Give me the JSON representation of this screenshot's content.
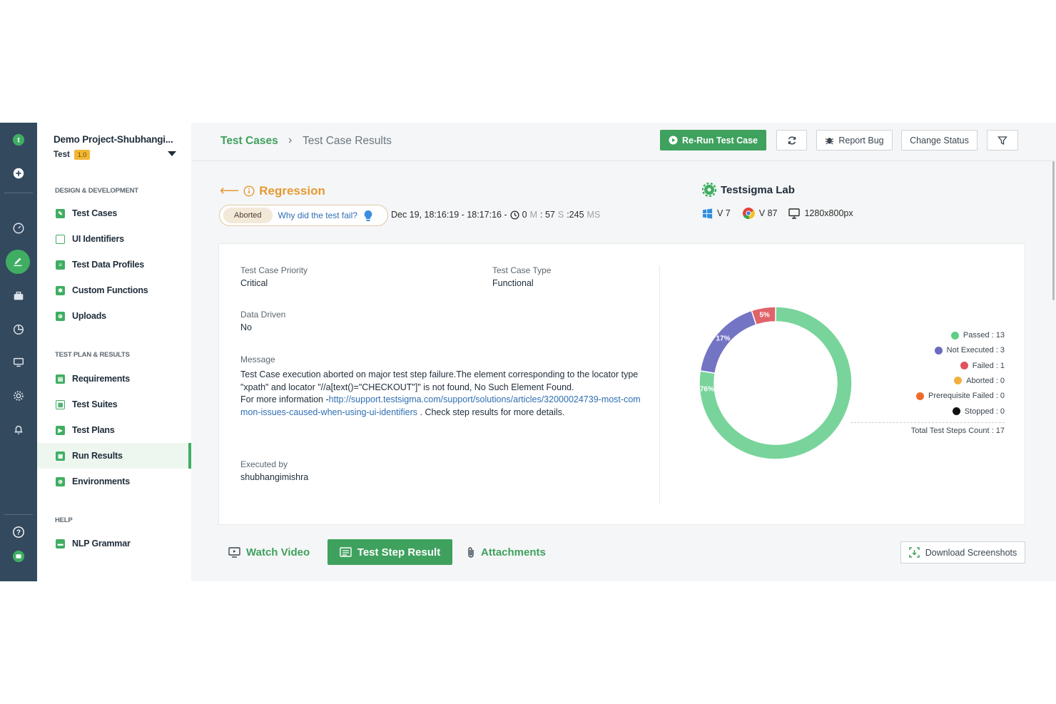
{
  "sidebar": {
    "project_name": "Demo Project-Shubhangi...",
    "project_sub": "Test",
    "version": "1.0",
    "sections": [
      {
        "title": "DESIGN & DEVELOPMENT",
        "items": [
          "Test Cases",
          "UI Identifiers",
          "Test Data Profiles",
          "Custom Functions",
          "Uploads"
        ]
      },
      {
        "title": "TEST PLAN & RESULTS",
        "items": [
          "Requirements",
          "Test Suites",
          "Test Plans",
          "Run Results",
          "Environments"
        ]
      },
      {
        "title": "HELP",
        "items": [
          "NLP Grammar"
        ]
      }
    ],
    "selected": "Run Results"
  },
  "header": {
    "breadcrumb_root": "Test Cases",
    "breadcrumb_current": "Test Case Results",
    "rerun_label": "Re-Run Test Case",
    "report_bug_label": "Report Bug",
    "change_status_label": "Change Status"
  },
  "run": {
    "title": "Regression",
    "status": "Aborted",
    "why_link": "Why did the test fail?",
    "time_range": "Dec 19, 18:16:19 - 18:17:16 -",
    "duration_m_value": "0",
    "duration_m_unit": "M",
    "duration_s_value": ": 57",
    "duration_s_unit": "S",
    "duration_ms_value": ":245",
    "duration_ms_unit": "MS",
    "lab": "Testsigma Lab",
    "os_version": "V 7",
    "browser_version": "V 87",
    "resolution": "1280x800px"
  },
  "details": {
    "priority_label": "Test Case Priority",
    "priority_value": "Critical",
    "type_label": "Test Case Type",
    "type_value": "Functional",
    "data_driven_label": "Data Driven",
    "data_driven_value": "No",
    "message_label": "Message",
    "message_line1": "Test Case execution aborted on major test step failure.The element corresponding to the locator type \"xpath\" and locator \"//a[text()=\"CHECKOUT\"]\" is not found, No Such Element Found.",
    "message_prefix": "For more information -",
    "message_link": "http://support.testsigma.com/support/solutions/articles/32000024739-most-common-issues-caused-when-using-ui-identifiers",
    "message_suffix": " . Check step results for more details.",
    "executed_by_label": "Executed by",
    "executed_by_value": "shubhangimishra"
  },
  "chart_data": {
    "type": "pie",
    "categories": [
      "Passed",
      "Not Executed",
      "Failed"
    ],
    "values": [
      76,
      17,
      5
    ],
    "slice_labels": [
      "76%",
      "17%",
      "5%"
    ],
    "colors": [
      "#78d49a",
      "#7474c4",
      "#e0636a"
    ]
  },
  "legend": [
    {
      "label": "Passed : 13",
      "color": "#5fcf86"
    },
    {
      "label": "Not Executed : 3",
      "color": "#6b6bc0"
    },
    {
      "label": "Failed : 1",
      "color": "#e0525c"
    },
    {
      "label": "Aborted : 0",
      "color": "#f0b03e"
    },
    {
      "label": "Prerequisite Failed : 0",
      "color": "#f06a2a"
    },
    {
      "label": "Stopped : 0",
      "color": "#111111"
    }
  ],
  "total_steps": "Total Test Steps Count : 17",
  "tabs": {
    "watch_video": "Watch Video",
    "step_result": "Test Step Result",
    "attachments": "Attachments",
    "download": "Download Screenshots"
  }
}
